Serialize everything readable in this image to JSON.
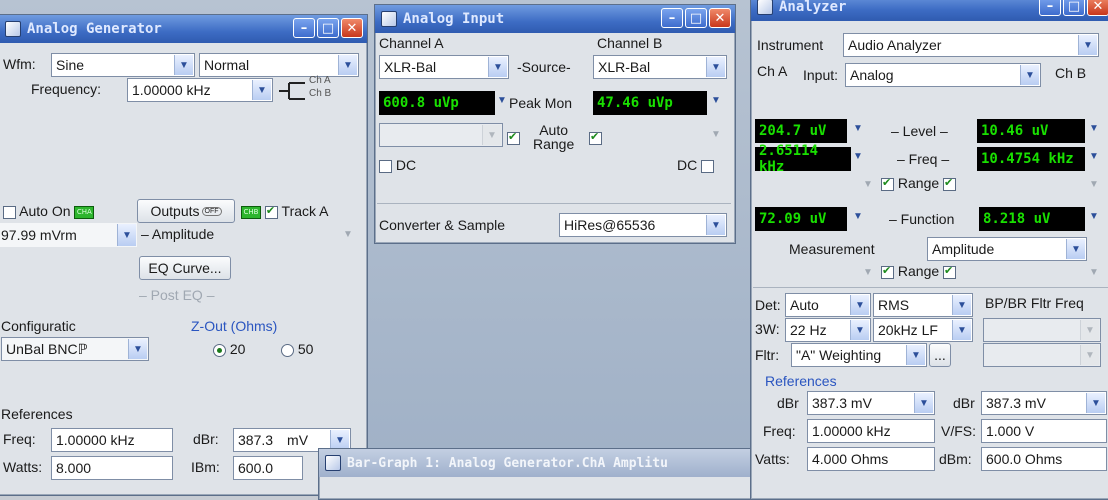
{
  "gen": {
    "title": "Analog Generator",
    "wfm_label": "Wfm:",
    "wfm_value": "Sine",
    "mode_value": "Normal",
    "freq_label": "Frequency:",
    "freq_value": "1.00000 kHz",
    "ch_a": "Ch A",
    "ch_b": "Ch B",
    "auto_on": "Auto On",
    "led_cha": "CHA",
    "led_chb": "CHB",
    "led_off": "OFF",
    "outputs": "Outputs",
    "track_a": "Track A",
    "amp_value": "97.99  mVrm",
    "amp_label": "– Amplitude",
    "eq_curve": "EQ Curve...",
    "post_eq": "– Post EQ –",
    "config_label": "Configuratic",
    "config_value": "UnBal BNCℙ",
    "zout_label": "Z-Out (Ohms)",
    "zout_20": "20",
    "zout_50": "50",
    "refs_label": "References",
    "freq_ref_label": "Freq:",
    "freq_ref_value": "1.00000 kHz",
    "dbr_label": "dBr:",
    "dbr_value": "387.3",
    "dbr_unit": "mV",
    "watts_label": "Watts:",
    "watts_value": "8.000",
    "dbm_label": "IBm:",
    "dbm_value": "600.0"
  },
  "input": {
    "title": "Analog Input",
    "cha_label": "Channel A",
    "chb_label": "Channel B",
    "cha_value": "XLR-Bal",
    "chb_value": "XLR-Bal",
    "source_label": "-Source-",
    "peak_a": "600.8  uVp",
    "peak_label": "Peak Mon",
    "peak_b": "47.46  uVp",
    "auto_range": "Auto\nRange",
    "dc_a": "DC",
    "dc_b": "DC",
    "conv_label": "Converter & Sample",
    "conv_value": "HiRes@65536"
  },
  "bar": {
    "title": "Bar-Graph 1: Analog Generator.ChA Amplitu"
  },
  "analyzer": {
    "title": "Analyzer",
    "instr_label": "Instrument",
    "instr_value": "Audio Analyzer",
    "cha_label": "Ch A",
    "input_label": "Input:",
    "input_value": "Analog",
    "chb_label": "Ch B",
    "level_a": "204.7  uV",
    "level_label": "– Level –",
    "level_b": "10.46  uV",
    "freq_a": "2.65114 kHz",
    "freq_label": "– Freq –",
    "freq_b": "10.4754 kHz",
    "range_label": "Range",
    "func_a": "72.09  uV",
    "func_label": "– Function",
    "func_b": "8.218  uV",
    "meas_label": "Measurement",
    "meas_value": "Amplitude",
    "det_label": "Det:",
    "det_value": "Auto",
    "rms_value": "RMS",
    "bpbr_label": "BP/BR Fltr Freq",
    "bw_label": "3W:",
    "bw_value": "22 Hz",
    "bw2_value": "20kHz LF",
    "fltr_label": "Fltr:",
    "fltr_value": "\"A\" Weighting",
    "more_btn": "...",
    "refs_label": "References",
    "dbr_a_label": "dBr",
    "dbr_a_value": "387.3  mV",
    "dbr_b_label": "dBr",
    "dbr_b_value": "387.3   mV",
    "freq_ref_label": "Freq:",
    "freq_ref_value": "1.00000 kHz",
    "vfs_label": "V/FS:",
    "vfs_value": "1.000    V",
    "watts_label": "Vatts:",
    "watts_value": "4.000    Ohms",
    "dbm_label": "dBm:",
    "dbm_value": "600.0    Ohms"
  },
  "colors": {
    "titlebar": "#3d6cc4",
    "meter_bg": "#000000",
    "meter_fg": "#19e000",
    "panel": "#dfe3e8"
  }
}
